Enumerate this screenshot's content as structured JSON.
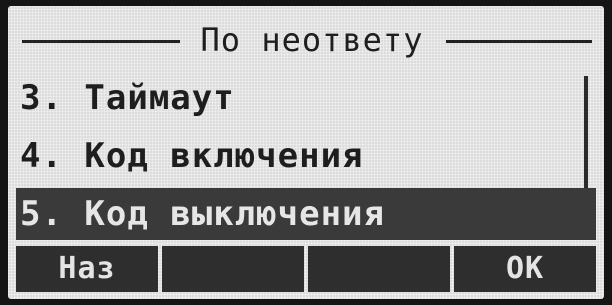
{
  "screen": {
    "title": "По неответу"
  },
  "menu": {
    "items": [
      {
        "label": "3. Таймаут",
        "selected": false
      },
      {
        "label": "4. Код включения",
        "selected": false
      },
      {
        "label": "5. Код выключения",
        "selected": true
      }
    ]
  },
  "softkeys": {
    "key1": "Наз",
    "key2": "",
    "key3": "",
    "key4": "OK"
  }
}
